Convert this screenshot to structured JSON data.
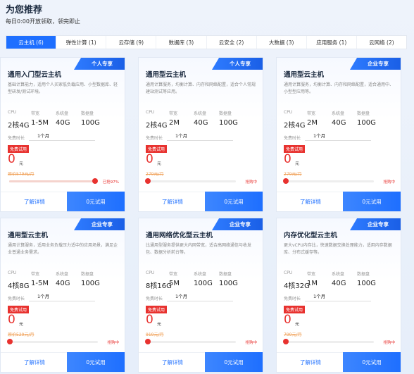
{
  "header": {
    "title": "为您推荐",
    "subtitle": "每日0:00开放领取，领完即止"
  },
  "tabs": [
    {
      "label": "云主机 (6)",
      "active": true
    },
    {
      "label": "弹性计算 (1)",
      "active": false
    },
    {
      "label": "云存储 (9)",
      "active": false
    },
    {
      "label": "数据库 (3)",
      "active": false
    },
    {
      "label": "云安全 (2)",
      "active": false
    },
    {
      "label": "大数据 (3)",
      "active": false
    },
    {
      "label": "应用服务 (1)",
      "active": false
    },
    {
      "label": "云网络 (2)",
      "active": false
    }
  ],
  "common": {
    "spec_labels": [
      "CPU",
      "带宽",
      "系统盘",
      "数据盘"
    ],
    "duration_label": "免费时长",
    "free_tag": "免费试用",
    "price_unit": "元",
    "detail_label": "了解详情",
    "try_label": "0元试用"
  },
  "cards": [
    {
      "badge": "个人专享",
      "title": "通用入门型云主机",
      "desc": "基础计算能力，适用个人买家低负载应用、小型数据库、轻型研发/测试环境。",
      "specs": [
        "2核4G",
        "1-5M",
        "40G",
        "100G"
      ],
      "duration": "1个月",
      "price": "0",
      "original": "原价579元/月",
      "progress": 0.97,
      "status": "已抢97%"
    },
    {
      "badge": "个人专享",
      "title": "通用型云主机",
      "desc": "通用计算服务，均衡计算、内存和网络配置，适合个人常规建站测试等应用。",
      "specs": [
        "2核4G",
        "2M",
        "40G",
        "100G"
      ],
      "duration": "1个月",
      "price": "0",
      "original": "279元/月",
      "progress": 0.0,
      "status": "抢购中"
    },
    {
      "badge": "企业专享",
      "title": "通用型云主机",
      "desc": "通用计算服务，均衡计算、内存和网络配置，适合通用中、小型型应用等。",
      "specs": [
        "2核4G",
        "2M",
        "40G",
        "100G"
      ],
      "duration": "1个月",
      "price": "0",
      "original": "279元/月",
      "progress": 0.0,
      "status": "抢购中"
    },
    {
      "badge": "企业专享",
      "title": "通用型云主机",
      "desc": "通用计算服务，适用业务负载压力适中的应用场景，满足企业普通业务需求。",
      "specs": [
        "4核8G",
        "1-5M",
        "40G",
        "100G"
      ],
      "duration": "1个月",
      "price": "0",
      "original": "原价529元/月",
      "progress": 0.0,
      "status": "抢购中"
    },
    {
      "badge": "企业专享",
      "title": "通用网络优化型云主机",
      "desc": "比通用型服务提供更大内网带宽，适合高网络通信与收发包、数据分析前台等。",
      "specs": [
        "8核16G",
        "5M",
        "100G",
        "100G"
      ],
      "duration": "1个月",
      "price": "0",
      "original": "919元/月",
      "progress": 0.0,
      "status": "抢购中"
    },
    {
      "badge": "企业专享",
      "title": "内存优化型云主机",
      "desc": "更大vCPU内存比，快速数据交换处理能力，适用内存数据库、分布式缓存等。",
      "specs": [
        "4核32G",
        "1M",
        "40G",
        "100G"
      ],
      "duration": "1个月",
      "price": "0",
      "original": "799元/月",
      "progress": 0.0,
      "status": "抢购中"
    }
  ]
}
